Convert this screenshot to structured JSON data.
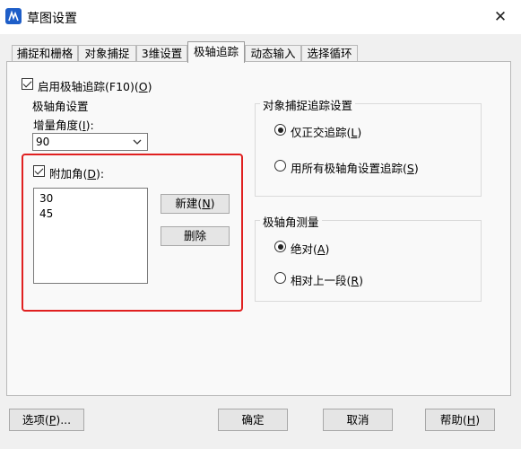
{
  "window": {
    "title": "草图设置",
    "close_symbol": "✕"
  },
  "tabs": [
    {
      "label": "捕捉和栅格"
    },
    {
      "label": "对象捕捉"
    },
    {
      "label": "3维设置"
    },
    {
      "label": "极轴追踪"
    },
    {
      "label": "动态输入"
    },
    {
      "label": "选择循环"
    }
  ],
  "active_tab": "极轴追踪",
  "enable_polar": {
    "label_pre": "启用极轴追踪(F10)(",
    "label_key": "O",
    "label_post": ")",
    "checked": true
  },
  "polar_angle_group": {
    "title": "极轴角设置",
    "increment": {
      "label_pre": "增量角度(",
      "label_key": "I",
      "label_post": "):",
      "value": "90"
    },
    "additional": {
      "label_pre": "附加角(",
      "label_key": "D",
      "label_post": "):",
      "checked": true,
      "angles": [
        "30",
        "45"
      ],
      "new_button": {
        "pre": "新建(",
        "key": "N",
        "post": ")"
      },
      "delete_button": {
        "label": "删除"
      }
    }
  },
  "object_snap_group": {
    "title": "对象捕捉追踪设置",
    "options": [
      {
        "pre": "仅正交追踪(",
        "key": "L",
        "post": ")",
        "selected": true
      },
      {
        "pre": "用所有极轴角设置追踪(",
        "key": "S",
        "post": ")",
        "selected": false
      }
    ]
  },
  "polar_measure_group": {
    "title": "极轴角测量",
    "options": [
      {
        "pre": "绝对(",
        "key": "A",
        "post": ")",
        "selected": true
      },
      {
        "pre": "相对上一段(",
        "key": "R",
        "post": ")",
        "selected": false
      }
    ]
  },
  "footer": {
    "options_button": {
      "pre": "选项(",
      "key": "P",
      "post": ")..."
    },
    "ok_button": {
      "label": "确定"
    },
    "cancel_button": {
      "label": "取消"
    },
    "help_button": {
      "pre": "帮助(",
      "key": "H",
      "post": ")"
    }
  },
  "colors": {
    "highlight_border": "#e02020",
    "accent": "#1e5ec8"
  }
}
